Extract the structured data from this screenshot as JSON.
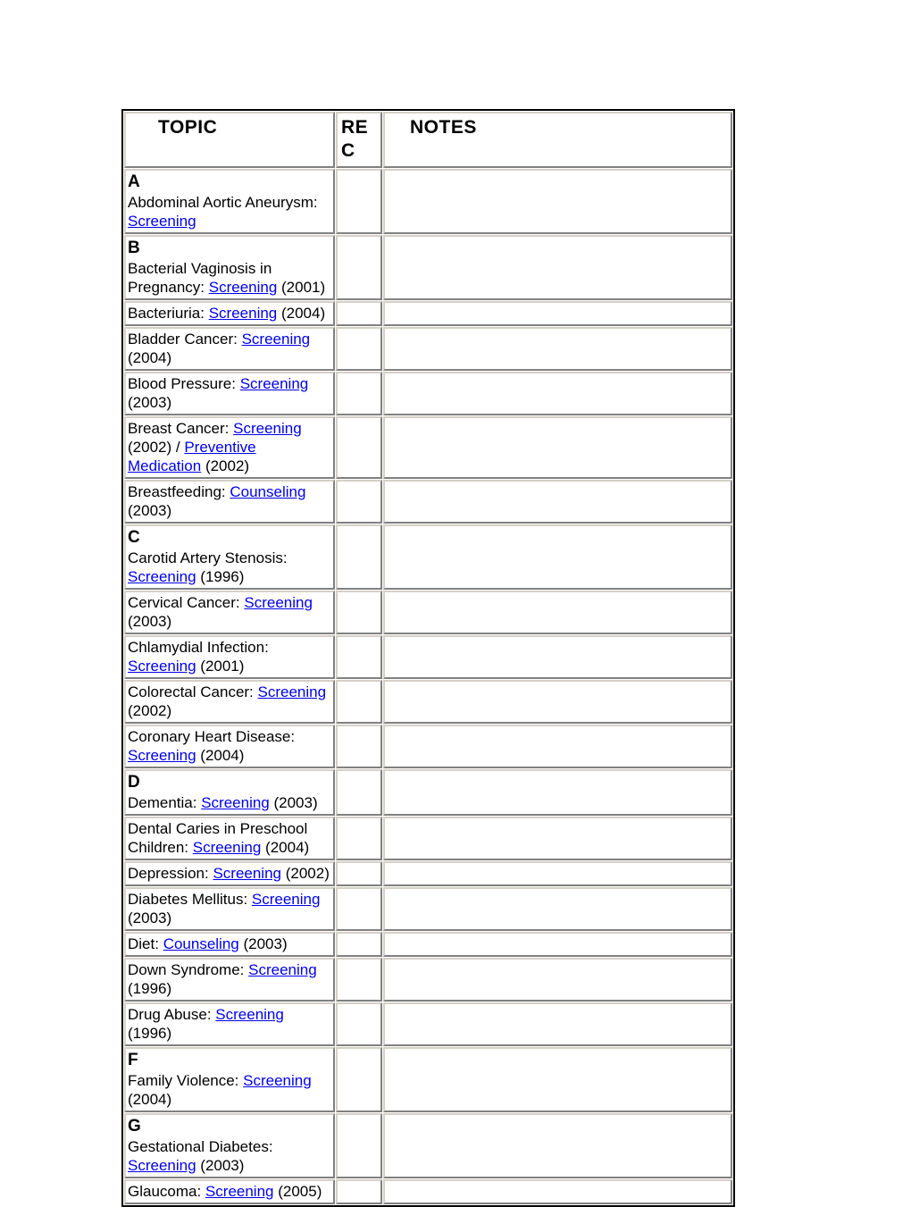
{
  "table": {
    "columns": [
      {
        "key": "topic",
        "label": "TOPIC"
      },
      {
        "key": "rec",
        "label": "REC"
      },
      {
        "key": "notes",
        "label": "NOTES"
      }
    ],
    "link_color": "#0000ee",
    "text_color": "#000000",
    "border_color": "#808080",
    "outer_border_color": "#000000",
    "rows": [
      {
        "alpha": "A",
        "segments": [
          {
            "text": "Abdominal Aortic Aneurysm: ",
            "link": false
          },
          {
            "text": "Screening",
            "link": true
          }
        ],
        "rec": "",
        "notes": ""
      },
      {
        "alpha": "B",
        "segments": [
          {
            "text": "Bacterial Vaginosis in Pregnancy: ",
            "link": false
          },
          {
            "text": "Screening",
            "link": true
          },
          {
            "text": " (2001)",
            "link": false
          }
        ],
        "rec": "",
        "notes": ""
      },
      {
        "alpha": "",
        "segments": [
          {
            "text": "Bacteriuria: ",
            "link": false
          },
          {
            "text": "Screening",
            "link": true
          },
          {
            "text": " (2004)",
            "link": false
          }
        ],
        "rec": "",
        "notes": ""
      },
      {
        "alpha": "",
        "segments": [
          {
            "text": "Bladder Cancer: ",
            "link": false
          },
          {
            "text": "Screening",
            "link": true
          },
          {
            "text": " (2004)",
            "link": false
          }
        ],
        "rec": "",
        "notes": ""
      },
      {
        "alpha": "",
        "segments": [
          {
            "text": "Blood Pressure: ",
            "link": false
          },
          {
            "text": "Screening",
            "link": true
          },
          {
            "text": " (2003)",
            "link": false
          }
        ],
        "rec": "",
        "notes": ""
      },
      {
        "alpha": "",
        "segments": [
          {
            "text": "Breast Cancer: ",
            "link": false
          },
          {
            "text": "Screening",
            "link": true
          },
          {
            "text": " (2002) / ",
            "link": false
          },
          {
            "text": "Preventive Medication",
            "link": true
          },
          {
            "text": " (2002)",
            "link": false
          }
        ],
        "rec": "",
        "notes": ""
      },
      {
        "alpha": "",
        "segments": [
          {
            "text": "Breastfeeding: ",
            "link": false
          },
          {
            "text": "Counseling",
            "link": true
          },
          {
            "text": " (2003)",
            "link": false
          }
        ],
        "rec": "",
        "notes": ""
      },
      {
        "alpha": "C",
        "segments": [
          {
            "text": "Carotid Artery Stenosis: ",
            "link": false
          },
          {
            "text": "Screening",
            "link": true
          },
          {
            "text": " (1996)",
            "link": false
          }
        ],
        "rec": "",
        "notes": ""
      },
      {
        "alpha": "",
        "segments": [
          {
            "text": "Cervical Cancer: ",
            "link": false
          },
          {
            "text": "Screening",
            "link": true
          },
          {
            "text": " (2003)",
            "link": false
          }
        ],
        "rec": "",
        "notes": ""
      },
      {
        "alpha": "",
        "segments": [
          {
            "text": "Chlamydial Infection: ",
            "link": false
          },
          {
            "text": "Screening",
            "link": true
          },
          {
            "text": " (2001)",
            "link": false
          }
        ],
        "rec": "",
        "notes": ""
      },
      {
        "alpha": "",
        "segments": [
          {
            "text": "Colorectal Cancer: ",
            "link": false
          },
          {
            "text": "Screening",
            "link": true
          },
          {
            "text": " (2002)",
            "link": false
          }
        ],
        "rec": "",
        "notes": ""
      },
      {
        "alpha": "",
        "segments": [
          {
            "text": "Coronary Heart Disease: ",
            "link": false
          },
          {
            "text": "Screening",
            "link": true
          },
          {
            "text": " (2004)",
            "link": false
          }
        ],
        "rec": "",
        "notes": ""
      },
      {
        "alpha": "D",
        "segments": [
          {
            "text": "Dementia: ",
            "link": false
          },
          {
            "text": "Screening",
            "link": true
          },
          {
            "text": " (2003)",
            "link": false
          }
        ],
        "rec": "",
        "notes": ""
      },
      {
        "alpha": "",
        "segments": [
          {
            "text": "Dental Caries in Preschool Children: ",
            "link": false
          },
          {
            "text": "Screening",
            "link": true
          },
          {
            "text": " (2004)",
            "link": false
          }
        ],
        "rec": "",
        "notes": ""
      },
      {
        "alpha": "",
        "segments": [
          {
            "text": "Depression: ",
            "link": false
          },
          {
            "text": "Screening",
            "link": true
          },
          {
            "text": " (2002)",
            "link": false
          }
        ],
        "rec": "",
        "notes": ""
      },
      {
        "alpha": "",
        "segments": [
          {
            "text": "Diabetes Mellitus: ",
            "link": false
          },
          {
            "text": "Screening",
            "link": true
          },
          {
            "text": " (2003)",
            "link": false
          }
        ],
        "rec": "",
        "notes": ""
      },
      {
        "alpha": "",
        "segments": [
          {
            "text": "Diet: ",
            "link": false
          },
          {
            "text": "Counseling",
            "link": true
          },
          {
            "text": " (2003)",
            "link": false
          }
        ],
        "rec": "",
        "notes": ""
      },
      {
        "alpha": "",
        "segments": [
          {
            "text": "Down Syndrome: ",
            "link": false
          },
          {
            "text": "Screening",
            "link": true
          },
          {
            "text": " (1996)",
            "link": false
          }
        ],
        "rec": "",
        "notes": ""
      },
      {
        "alpha": "",
        "segments": [
          {
            "text": "Drug Abuse: ",
            "link": false
          },
          {
            "text": "Screening",
            "link": true
          },
          {
            "text": " (1996)",
            "link": false
          }
        ],
        "rec": "",
        "notes": ""
      },
      {
        "alpha": "F",
        "segments": [
          {
            "text": "Family Violence: ",
            "link": false
          },
          {
            "text": "Screening",
            "link": true
          },
          {
            "text": " (2004)",
            "link": false
          }
        ],
        "rec": "",
        "notes": ""
      },
      {
        "alpha": "G",
        "segments": [
          {
            "text": "Gestational Diabetes: ",
            "link": false
          },
          {
            "text": "Screening",
            "link": true
          },
          {
            "text": " (2003)",
            "link": false
          }
        ],
        "rec": "",
        "notes": ""
      },
      {
        "alpha": "",
        "segments": [
          {
            "text": "Glaucoma: ",
            "link": false
          },
          {
            "text": "Screening",
            "link": true
          },
          {
            "text": " (2005)",
            "link": false
          }
        ],
        "rec": "",
        "notes": ""
      }
    ]
  }
}
